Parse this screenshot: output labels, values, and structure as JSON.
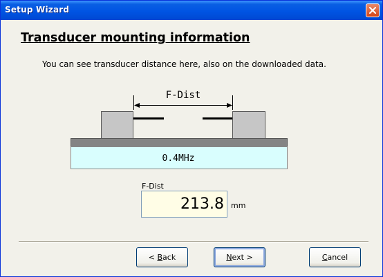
{
  "window": {
    "title": "Setup Wizard"
  },
  "page": {
    "heading": "Transducer mounting information",
    "description": "You can see transducer distance here, also on the downloaded data."
  },
  "diagram": {
    "distance_label": "F-Dist",
    "frequency_label": "0.4MHz"
  },
  "measurement": {
    "label": "F-Dist",
    "value": "213.8",
    "unit": "mm"
  },
  "buttons": {
    "back": {
      "mnemonic": "B",
      "prefix": "< ",
      "rest": "ack"
    },
    "next": {
      "mnemonic": "N",
      "prefix": "",
      "rest": "ext >"
    },
    "cancel": {
      "mnemonic": "C",
      "prefix": "",
      "rest": "ancel"
    }
  },
  "icons": {
    "close": "close-icon"
  },
  "colors": {
    "titlebar": "#0054e3",
    "pipe_fluid": "#d9fefe",
    "pipe_wall": "#848484",
    "transducer": "#c6c6c6",
    "value_box": "#fffde6"
  }
}
